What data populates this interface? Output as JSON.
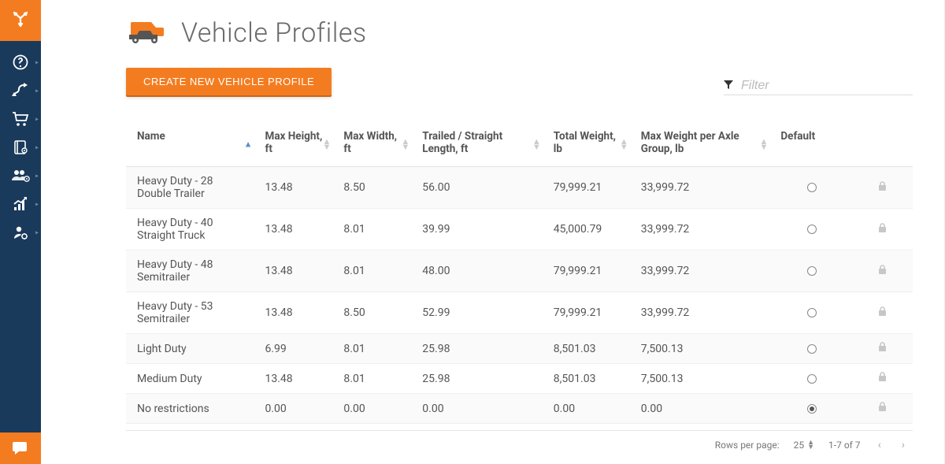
{
  "brand": {
    "accent": "#f47c20",
    "dark": "#1a3a5c"
  },
  "page": {
    "title": "Vehicle Profiles",
    "create_button": "CREATE NEW VEHICLE PROFILE",
    "filter_placeholder": "Filter"
  },
  "sidebar": {
    "items": [
      {
        "id": "help",
        "icon": "question-circle"
      },
      {
        "id": "routes",
        "icon": "route-arrows"
      },
      {
        "id": "orders",
        "icon": "cart"
      },
      {
        "id": "address",
        "icon": "book-pin"
      },
      {
        "id": "team",
        "icon": "users-pin"
      },
      {
        "id": "reports",
        "icon": "chart-up"
      },
      {
        "id": "account",
        "icon": "user-gear"
      }
    ]
  },
  "table": {
    "headers": {
      "name": "Name",
      "max_height": "Max Height, ft",
      "max_width": "Max Width, ft",
      "length": "Trailed / Straight Length, ft",
      "total_weight": "Total Weight, lb",
      "axle_weight": "Max Weight per Axle Group, lb",
      "default": "Default"
    },
    "rows": [
      {
        "name": "Heavy Duty - 28 Double Trailer",
        "h": "13.48",
        "w": "8.50",
        "len": "56.00",
        "tw": "79,999.21",
        "ax": "33,999.72",
        "default": false,
        "locked": true
      },
      {
        "name": "Heavy Duty - 40 Straight Truck",
        "h": "13.48",
        "w": "8.01",
        "len": "39.99",
        "tw": "45,000.79",
        "ax": "33,999.72",
        "default": false,
        "locked": true
      },
      {
        "name": "Heavy Duty - 48 Semitrailer",
        "h": "13.48",
        "w": "8.01",
        "len": "48.00",
        "tw": "79,999.21",
        "ax": "33,999.72",
        "default": false,
        "locked": true
      },
      {
        "name": "Heavy Duty - 53 Semitrailer",
        "h": "13.48",
        "w": "8.50",
        "len": "52.99",
        "tw": "79,999.21",
        "ax": "33,999.72",
        "default": false,
        "locked": true
      },
      {
        "name": "Light Duty",
        "h": "6.99",
        "w": "8.01",
        "len": "25.98",
        "tw": "8,501.03",
        "ax": "7,500.13",
        "default": false,
        "locked": true
      },
      {
        "name": "Medium Duty",
        "h": "13.48",
        "w": "8.01",
        "len": "25.98",
        "tw": "8,501.03",
        "ax": "7,500.13",
        "default": false,
        "locked": true
      },
      {
        "name": "No restrictions",
        "h": "0.00",
        "w": "0.00",
        "len": "0.00",
        "tw": "0.00",
        "ax": "0.00",
        "default": true,
        "locked": true
      }
    ]
  },
  "pager": {
    "rows_per_page_label": "Rows per page:",
    "rows_per_page_value": "25",
    "range_text": "1-7 of 7"
  }
}
